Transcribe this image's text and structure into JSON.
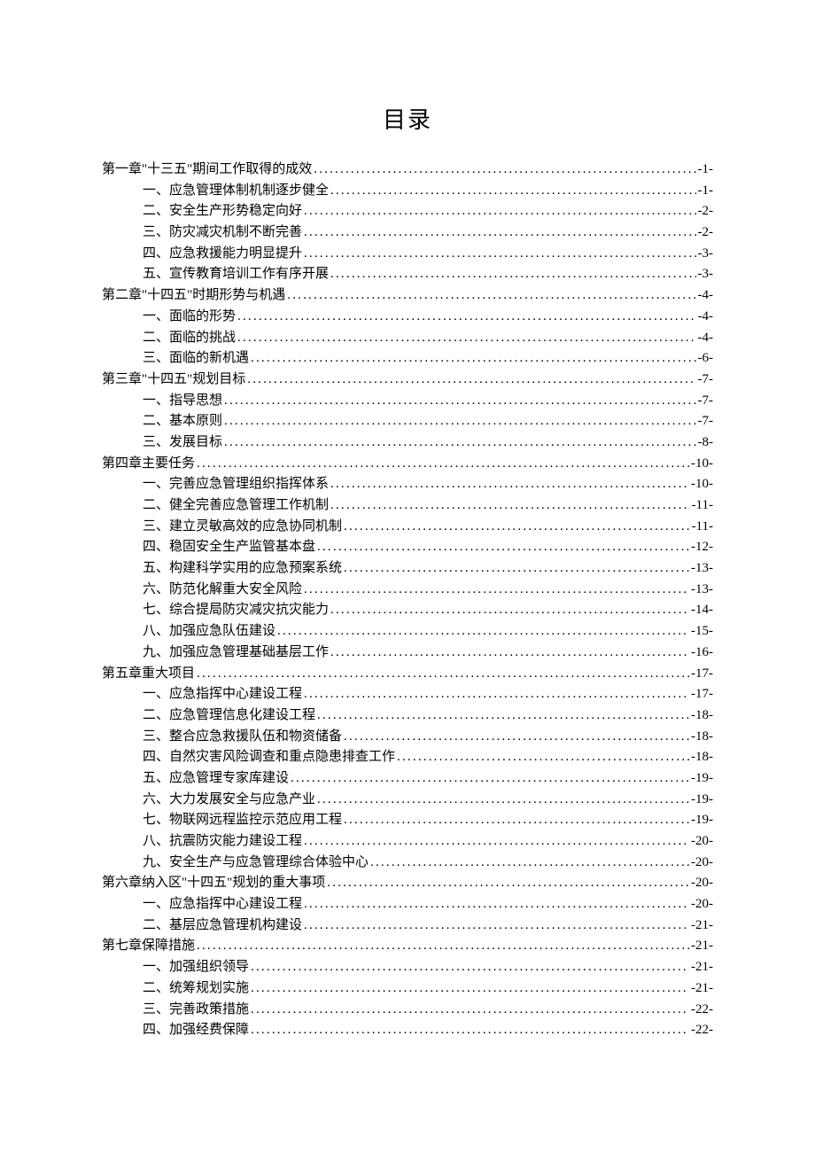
{
  "title": "目录",
  "toc": [
    {
      "level": 1,
      "label": "第一章\"十三五\"期间工作取得的成效",
      "page": "-1-"
    },
    {
      "level": 2,
      "label": "一、应急管理体制机制逐步健全",
      "page": "-1-"
    },
    {
      "level": 2,
      "label": "二、安全生产形势稳定向好",
      "page": "-2-"
    },
    {
      "level": 2,
      "label": "三、防灾减灾机制不断完善",
      "page": "-2-"
    },
    {
      "level": 2,
      "label": "四、应急救援能力明显提升",
      "page": "-3-"
    },
    {
      "level": 2,
      "label": "五、宣传教育培训工作有序开展",
      "page": "-3-"
    },
    {
      "level": 1,
      "label": "第二章\"十四五\"时期形势与机遇",
      "page": "-4-"
    },
    {
      "level": 2,
      "label": "一、面临的形势",
      "page": "-4-"
    },
    {
      "level": 2,
      "label": "二、面临的挑战",
      "page": "-4-"
    },
    {
      "level": 2,
      "label": "三、面临的新机遇",
      "page": "-6-"
    },
    {
      "level": 1,
      "label": "第三章\"十四五\"规划目标",
      "page": "-7-"
    },
    {
      "level": 2,
      "label": "一、指导思想",
      "page": "-7-"
    },
    {
      "level": 2,
      "label": "二、基本原则",
      "page": "-7-"
    },
    {
      "level": 2,
      "label": "三、发展目标",
      "page": "-8-"
    },
    {
      "level": 1,
      "label": "第四章主要任务",
      "page": "-10-"
    },
    {
      "level": 2,
      "label": "一、完善应急管理组织指挥体系",
      "page": "-10-"
    },
    {
      "level": 2,
      "label": "二、健全完善应急管理工作机制",
      "page": "-11-"
    },
    {
      "level": 2,
      "label": "三、建立灵敏高效的应急协同机制",
      "page": "-11-"
    },
    {
      "level": 2,
      "label": "四、稳固安全生产监管基本盘",
      "page": "-12-"
    },
    {
      "level": 2,
      "label": "五、构建科学实用的应急预案系统",
      "page": "-13-"
    },
    {
      "level": 2,
      "label": "六、防范化解重大安全风险",
      "page": "-13-"
    },
    {
      "level": 2,
      "label": "七、综合提局防灾减灾抗灾能力",
      "page": "-14-"
    },
    {
      "level": 2,
      "label": "八、加强应急队伍建设",
      "page": "-15-"
    },
    {
      "level": 2,
      "label": "九、加强应急管理基础基层工作",
      "page": "-16-"
    },
    {
      "level": 1,
      "label": "第五章重大项目",
      "page": "-17-"
    },
    {
      "level": 2,
      "label": "一、应急指挥中心建设工程",
      "page": "-17-"
    },
    {
      "level": 2,
      "label": "二、应急管理信息化建设工程",
      "page": "-18-"
    },
    {
      "level": 2,
      "label": "三、整合应急救援队伍和物资储备",
      "page": "-18-"
    },
    {
      "level": 2,
      "label": "四、自然灾害风险调查和重点隐患排查工作",
      "page": "-18-"
    },
    {
      "level": 2,
      "label": "五、应急管理专家库建设",
      "page": "-19-"
    },
    {
      "level": 2,
      "label": "六、大力发展安全与应急产业",
      "page": "-19-"
    },
    {
      "level": 2,
      "label": "七、物联网远程监控示范应用工程",
      "page": "-19-"
    },
    {
      "level": 2,
      "label": "八、抗震防灾能力建设工程",
      "page": "-20-"
    },
    {
      "level": 2,
      "label": "九、安全生产与应急管理综合体验中心",
      "page": "-20-"
    },
    {
      "level": 1,
      "label": "第六章纳入区\"十四五\"规划的重大事项",
      "page": "-20-"
    },
    {
      "level": 2,
      "label": "一、应急指挥中心建设工程",
      "page": "-20-"
    },
    {
      "level": 2,
      "label": "二、基层应急管理机构建设",
      "page": "-21-"
    },
    {
      "level": 1,
      "label": "第七章保障措施",
      "page": "-21-"
    },
    {
      "level": 2,
      "label": "一、加强组织领导",
      "page": "-21-"
    },
    {
      "level": 2,
      "label": "二、统筹规划实施",
      "page": "-21-"
    },
    {
      "level": 2,
      "label": "三、完善政策措施",
      "page": "-22-"
    },
    {
      "level": 2,
      "label": "四、加强经费保障",
      "page": "-22-"
    }
  ]
}
